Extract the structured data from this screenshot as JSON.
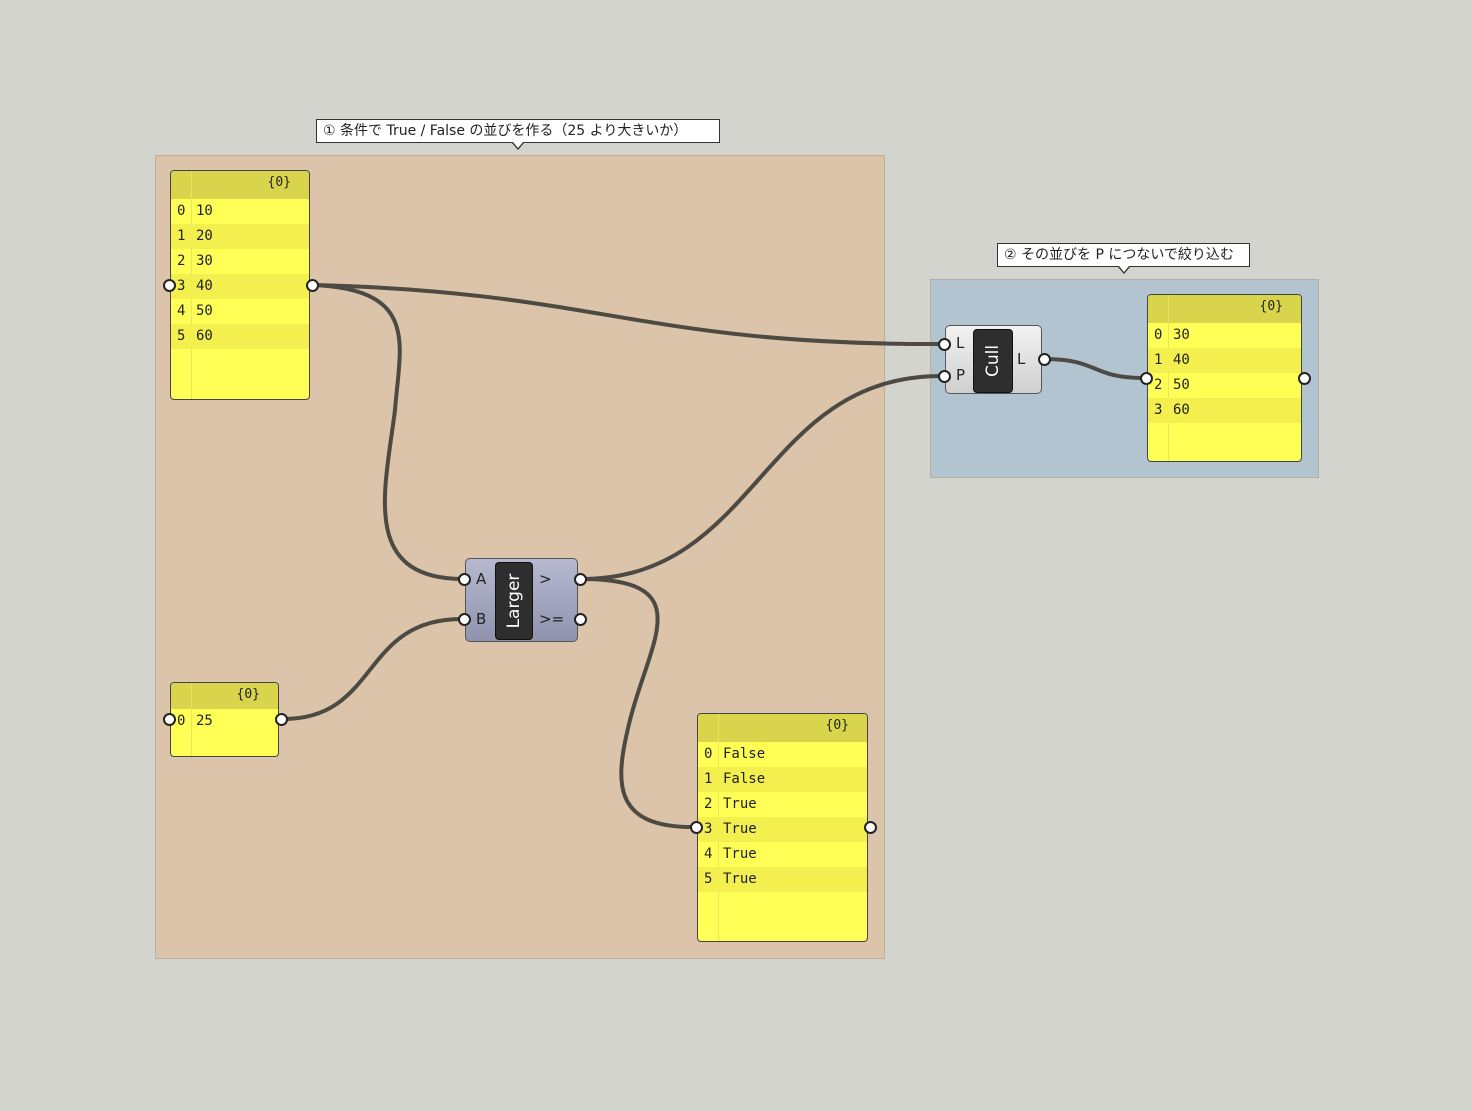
{
  "colors": {
    "canvas": "#d4d4cf",
    "group_tan": "#dbc4a9",
    "group_blue": "#b3c4d1",
    "panel_yellow": "#ffff55",
    "wire": "#4d4a44"
  },
  "callouts": {
    "group1": "① 条件で True / False の並びを作る（25 より大きいか）",
    "group2": "② その並びを P につないで絞り込む"
  },
  "panels": {
    "numbers": {
      "header": "{0}",
      "rows": [
        {
          "i": "0",
          "v": "10"
        },
        {
          "i": "1",
          "v": "20"
        },
        {
          "i": "2",
          "v": "30"
        },
        {
          "i": "3",
          "v": "40"
        },
        {
          "i": "4",
          "v": "50"
        },
        {
          "i": "5",
          "v": "60"
        }
      ]
    },
    "threshold": {
      "header": "{0}",
      "rows": [
        {
          "i": "0",
          "v": "25"
        }
      ]
    },
    "pattern": {
      "header": "{0}",
      "rows": [
        {
          "i": "0",
          "v": "False"
        },
        {
          "i": "1",
          "v": "False"
        },
        {
          "i": "2",
          "v": "True"
        },
        {
          "i": "3",
          "v": "True"
        },
        {
          "i": "4",
          "v": "True"
        },
        {
          "i": "5",
          "v": "True"
        }
      ]
    },
    "result": {
      "header": "{0}",
      "rows": [
        {
          "i": "0",
          "v": "30"
        },
        {
          "i": "1",
          "v": "40"
        },
        {
          "i": "2",
          "v": "50"
        },
        {
          "i": "3",
          "v": "60"
        }
      ]
    }
  },
  "components": {
    "larger": {
      "name": "Larger",
      "inputs": [
        "A",
        "B"
      ],
      "outputs": [
        ">",
        ">="
      ]
    },
    "cull": {
      "name": "Cull",
      "inputs": [
        "L",
        "P"
      ],
      "outputs": [
        "L"
      ]
    }
  }
}
